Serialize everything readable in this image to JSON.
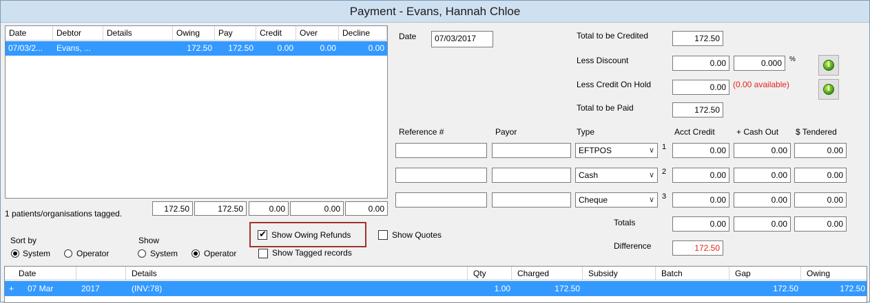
{
  "window": {
    "title": "Payment - Evans, Hannah Chloe"
  },
  "debtor_grid": {
    "columns": [
      "Date",
      "Debtor",
      "Details",
      "Owing",
      "Pay",
      "Credit",
      "Over",
      "Decline"
    ],
    "rows": [
      {
        "date": "07/03/2...",
        "debtor": "Evans, ...",
        "details": "",
        "owing": "172.50",
        "pay": "172.50",
        "credit": "0.00",
        "over": "0.00",
        "decline": "0.00"
      }
    ],
    "tagged_text": "1 patients/organisations tagged.",
    "totals": {
      "owing": "172.50",
      "pay": "172.50",
      "credit": "0.00",
      "over": "0.00",
      "decline": "0.00"
    }
  },
  "date": {
    "label": "Date",
    "value": "07/03/2017"
  },
  "totals_panel": {
    "to_be_credited_label": "Total to be Credited",
    "to_be_credited": "172.50",
    "less_discount_label": "Less Discount",
    "less_discount": "0.00",
    "discount_percent": "0.000",
    "percent_sign": "%",
    "less_credit_hold_label": "Less Credit On Hold",
    "less_credit_hold": "0.00",
    "available_text": "(0.00 available)",
    "to_be_paid_label": "Total to be Paid",
    "to_be_paid": "172.50"
  },
  "payments": {
    "headers": {
      "reference": "Reference #",
      "payor": "Payor",
      "type": "Type",
      "acct_credit": "Acct Credit",
      "cash_out": "+ Cash Out",
      "tendered": "$ Tendered"
    },
    "rows": [
      {
        "reference": "",
        "payor": "",
        "type": "EFTPOS",
        "index": "1",
        "acct_credit": "0.00",
        "cash_out": "0.00",
        "tendered": "0.00"
      },
      {
        "reference": "",
        "payor": "",
        "type": "Cash",
        "index": "2",
        "acct_credit": "0.00",
        "cash_out": "0.00",
        "tendered": "0.00"
      },
      {
        "reference": "",
        "payor": "",
        "type": "Cheque",
        "index": "3",
        "acct_credit": "0.00",
        "cash_out": "0.00",
        "tendered": "0.00"
      }
    ],
    "totals_label": "Totals",
    "totals": {
      "acct_credit": "0.00",
      "cash_out": "0.00",
      "tendered": "0.00"
    },
    "difference_label": "Difference",
    "difference": "172.50"
  },
  "options": {
    "show_owing_refunds": "Show Owing Refunds",
    "show_quotes": "Show Quotes",
    "show_tagged_records": "Show Tagged records",
    "sort_by_label": "Sort by",
    "show_label": "Show",
    "system": "System",
    "operator": "Operator"
  },
  "invoice_grid": {
    "columns": [
      "Date",
      "",
      "Details",
      "Qty",
      "Charged",
      "Subsidy",
      "Batch",
      "Gap",
      "Owing"
    ],
    "rows": [
      {
        "expander": "+",
        "date": "07 Mar",
        "year": "2017",
        "details": "(INV:78)",
        "qty": "1.00",
        "charged": "172.50",
        "subsidy": "",
        "batch": "",
        "gap": "172.50",
        "owing": "172.50"
      }
    ]
  },
  "colors": {
    "selection": "#3399ff",
    "highlight_border": "#a3312e",
    "warning_text": "#e4221b"
  },
  "icons": {
    "info_button": "info-icon"
  }
}
